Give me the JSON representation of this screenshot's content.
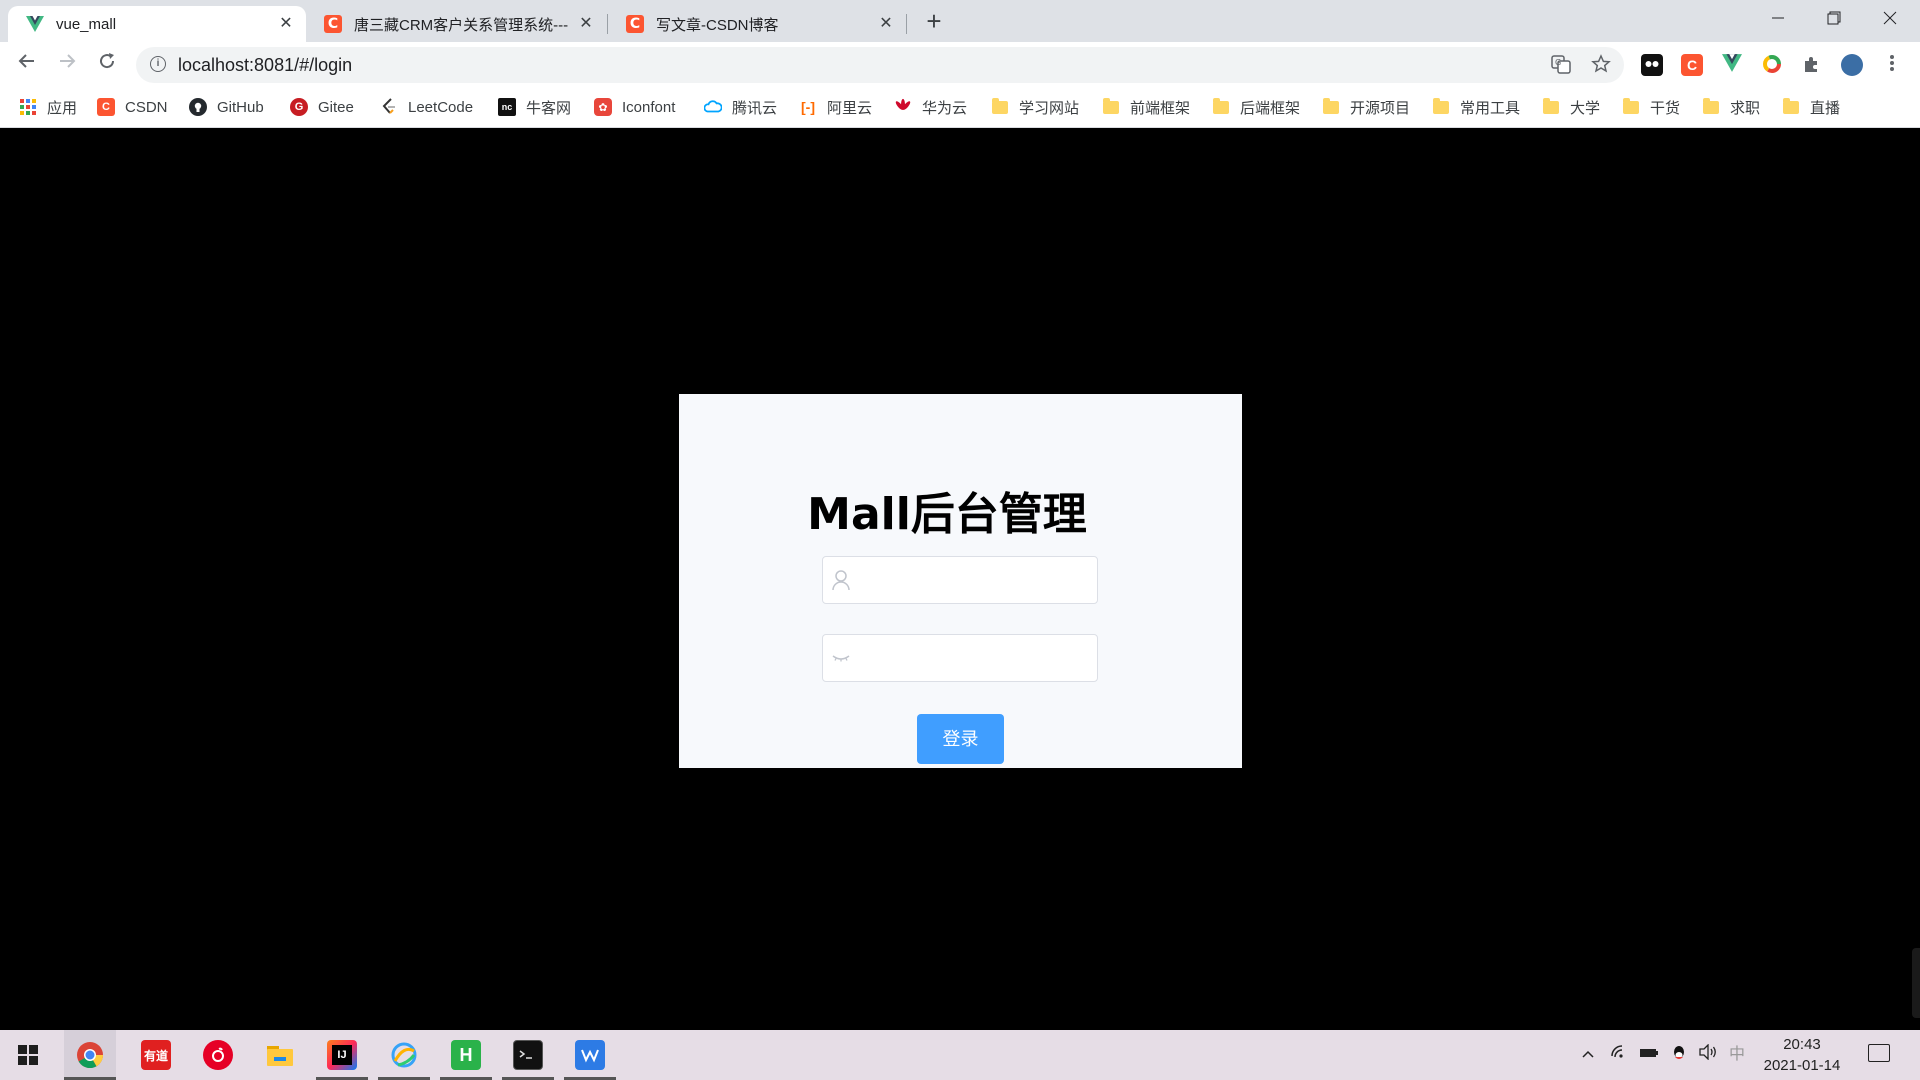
{
  "browser": {
    "tabs": [
      {
        "title": "vue_mall",
        "icon": "vue-logo-icon",
        "active": true
      },
      {
        "title": "唐三藏CRM客户关系管理系统---",
        "icon": "csdn-icon",
        "active": false
      },
      {
        "title": "写文章-CSDN博客",
        "icon": "csdn-icon",
        "active": false
      }
    ],
    "tab_close_glyph": "✕",
    "new_tab_glyph": "+",
    "url": "localhost:8081/#/login",
    "bookmarks": [
      {
        "label": "应用",
        "icon": "apps-grid-icon"
      },
      {
        "label": "CSDN",
        "icon": "csdn-icon"
      },
      {
        "label": "GitHub",
        "icon": "github-icon"
      },
      {
        "label": "Gitee",
        "icon": "gitee-icon"
      },
      {
        "label": "LeetCode",
        "icon": "leetcode-icon"
      },
      {
        "label": "牛客网",
        "icon": "nowcoder-icon"
      },
      {
        "label": "Iconfont",
        "icon": "iconfont-icon"
      },
      {
        "label": "腾讯云",
        "icon": "tencent-cloud-icon"
      },
      {
        "label": "阿里云",
        "icon": "aliyun-icon"
      },
      {
        "label": "华为云",
        "icon": "huawei-cloud-icon"
      },
      {
        "label": "学习网站",
        "icon": "folder-icon"
      },
      {
        "label": "前端框架",
        "icon": "folder-icon"
      },
      {
        "label": "后端框架",
        "icon": "folder-icon"
      },
      {
        "label": "开源项目",
        "icon": "folder-icon"
      },
      {
        "label": "常用工具",
        "icon": "folder-icon"
      },
      {
        "label": "大学",
        "icon": "folder-icon"
      },
      {
        "label": "干货",
        "icon": "folder-icon"
      },
      {
        "label": "求职",
        "icon": "folder-icon"
      },
      {
        "label": "直播",
        "icon": "folder-icon"
      }
    ]
  },
  "login": {
    "title": "Mall后台管理",
    "username_value": "",
    "password_value": "",
    "submit_label": "登录",
    "accent_color": "#409eff"
  },
  "taskbar": {
    "apps": [
      "chrome-icon",
      "youdao-icon",
      "netease-music-icon",
      "file-explorer-icon",
      "intellij-icon",
      "browser-icon",
      "hbuilder-icon",
      "terminal-icon",
      "wps-icon"
    ],
    "youdao_label": "有道",
    "hbuilder_label": "H",
    "ime_label": "中",
    "time": "20:43",
    "date": "2021-01-14"
  },
  "colors": {
    "page_background": "#000000",
    "card_background": "#f7f9fc",
    "csdn": "#fc5531",
    "vue": "#41b883"
  }
}
